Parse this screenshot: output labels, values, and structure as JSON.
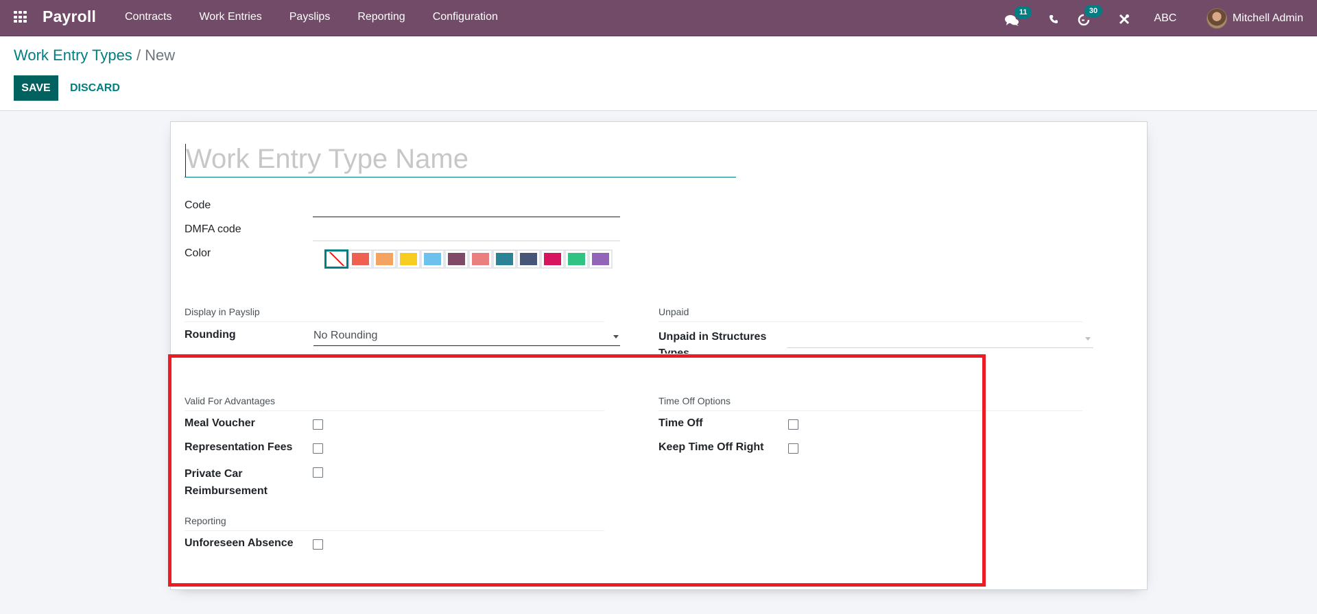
{
  "navbar": {
    "app_name": "Payroll",
    "menu": [
      {
        "label": "Contracts"
      },
      {
        "label": "Work Entries"
      },
      {
        "label": "Payslips"
      },
      {
        "label": "Reporting"
      },
      {
        "label": "Configuration"
      }
    ],
    "systray": {
      "messages_icon": "chat-bubbles-icon",
      "messages_count": "11",
      "phone_icon": "phone-icon",
      "activities_icon": "clock-icon",
      "activities_count": "30",
      "tools_icon": "tools-icon",
      "company": "ABC",
      "user_name": "Mitchell Admin"
    },
    "colors": {
      "background": "#714b67",
      "badge": "#017e84"
    }
  },
  "control_panel": {
    "breadcrumb": [
      {
        "label": "Work Entry Types"
      },
      {
        "label": "New"
      }
    ],
    "breadcrumb_separator": "/",
    "save_label": "SAVE",
    "discard_label": "DISCARD"
  },
  "form": {
    "name": {
      "value": "",
      "placeholder": "Work Entry Type Name"
    },
    "code": {
      "label": "Code",
      "value": ""
    },
    "dmfa_code": {
      "label": "DMFA code",
      "value": ""
    },
    "color": {
      "label": "Color",
      "selected_index": 0,
      "swatches": [
        "none",
        "#f06050",
        "#f4a460",
        "#f7cd1f",
        "#6cc1ed",
        "#814968",
        "#eb7e7f",
        "#2c8397",
        "#475577",
        "#d6145f",
        "#30c381",
        "#9365b8"
      ]
    },
    "display_in_payslip": {
      "title": "Display in Payslip",
      "rounding": {
        "label": "Rounding",
        "value": "No Rounding"
      }
    },
    "unpaid": {
      "title": "Unpaid",
      "unpaid_in_structures": {
        "label": "Unpaid in Structures Types",
        "value": ""
      }
    },
    "valid_for_advantages": {
      "title": "Valid For Advantages",
      "fields": [
        {
          "label": "Meal Voucher",
          "checked": false
        },
        {
          "label": "Representation Fees",
          "checked": false
        },
        {
          "label": "Private Car Reimbursement",
          "checked": false
        }
      ]
    },
    "reporting": {
      "title": "Reporting",
      "fields": [
        {
          "label": "Unforeseen Absence",
          "checked": false
        }
      ]
    },
    "time_off_options": {
      "title": "Time Off Options",
      "fields": [
        {
          "label": "Time Off",
          "checked": false
        },
        {
          "label": "Keep Time Off Right",
          "checked": false
        }
      ]
    }
  },
  "annotation": {
    "color": "#ed1c24"
  }
}
